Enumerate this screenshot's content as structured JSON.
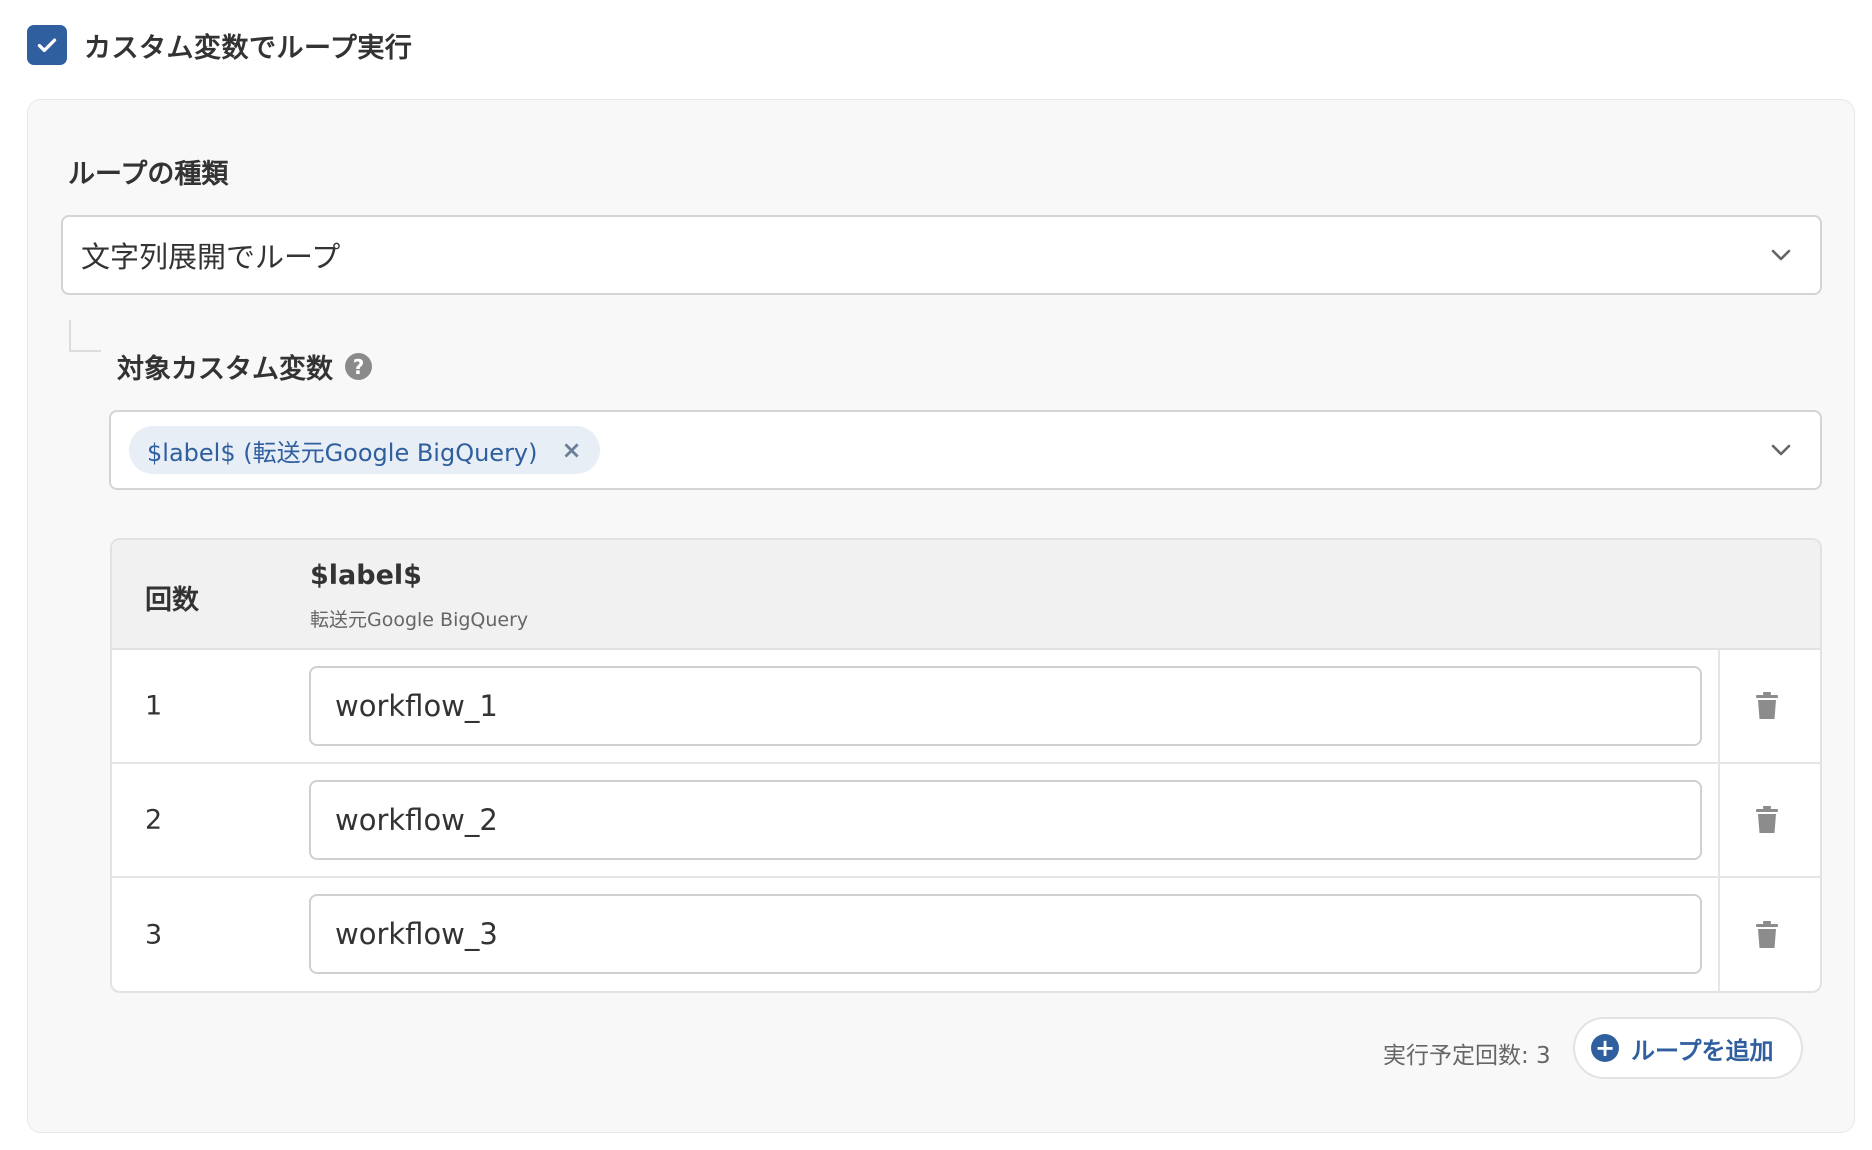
{
  "header": {
    "checkbox_checked": true,
    "label": "カスタム変数でループ実行"
  },
  "loop_type": {
    "label": "ループの種類",
    "selected": "文字列展開でループ"
  },
  "target_variable": {
    "label": "対象カスタム変数",
    "help_glyph": "?",
    "tag_label": "$label$ (転送元Google BigQuery)",
    "tag_close": "×"
  },
  "table": {
    "col_count_header": "回数",
    "col_var_header": "$label$",
    "col_var_subheader": "転送元Google BigQuery",
    "rows": [
      {
        "num": "1",
        "value": "workflow_1"
      },
      {
        "num": "2",
        "value": "workflow_2"
      },
      {
        "num": "3",
        "value": "workflow_3"
      }
    ]
  },
  "footer": {
    "scheduled_count": "実行予定回数: 3",
    "add_loop_label": "ループを追加",
    "add_loop_glyph": "+"
  },
  "colors": {
    "accent": "#2f5f9e",
    "tag_background": "#e8eef6",
    "panel_background": "#f8f8f8"
  },
  "icons": {
    "checkbox": "check-icon",
    "dropdown": "chevron-down-icon",
    "help": "question-circle-icon",
    "remove_tag": "close-icon",
    "delete_row": "trash-icon",
    "add": "plus-circle-icon"
  }
}
